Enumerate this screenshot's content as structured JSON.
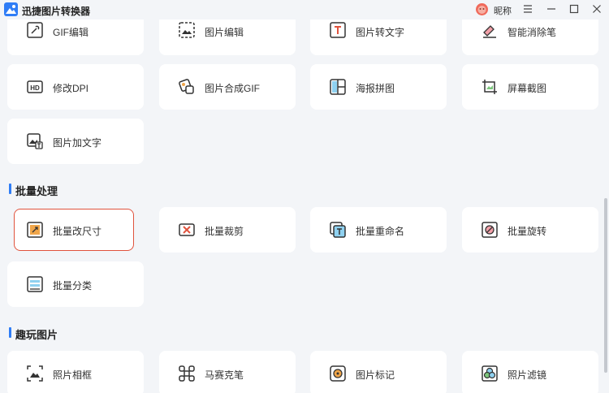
{
  "app": {
    "title": "迅捷图片转换器",
    "user_name": "昵称"
  },
  "sections": {
    "batch_title": "批量处理",
    "fun_title": "趣玩图片"
  },
  "cards": {
    "gif_edit": "GIF编辑",
    "image_edit": "图片编辑",
    "image_to_text": "图片转文字",
    "smart_eraser": "智能消除笔",
    "modify_dpi": "修改DPI",
    "image_to_gif": "图片合成GIF",
    "poster_collage": "海报拼图",
    "screenshot": "屏幕截图",
    "add_text": "图片加文字",
    "batch_resize": "批量改尺寸",
    "batch_crop": "批量裁剪",
    "batch_rename": "批量重命名",
    "batch_rotate": "批量旋转",
    "batch_classify": "批量分类",
    "photo_frame": "照片相框",
    "mosaic_pen": "马赛克笔",
    "image_mark": "图片标记",
    "photo_filter": "照片滤镜"
  },
  "colors": {
    "accent": "#2f7df6",
    "selected_border": "#e0533d",
    "background": "#f3f5f8"
  }
}
